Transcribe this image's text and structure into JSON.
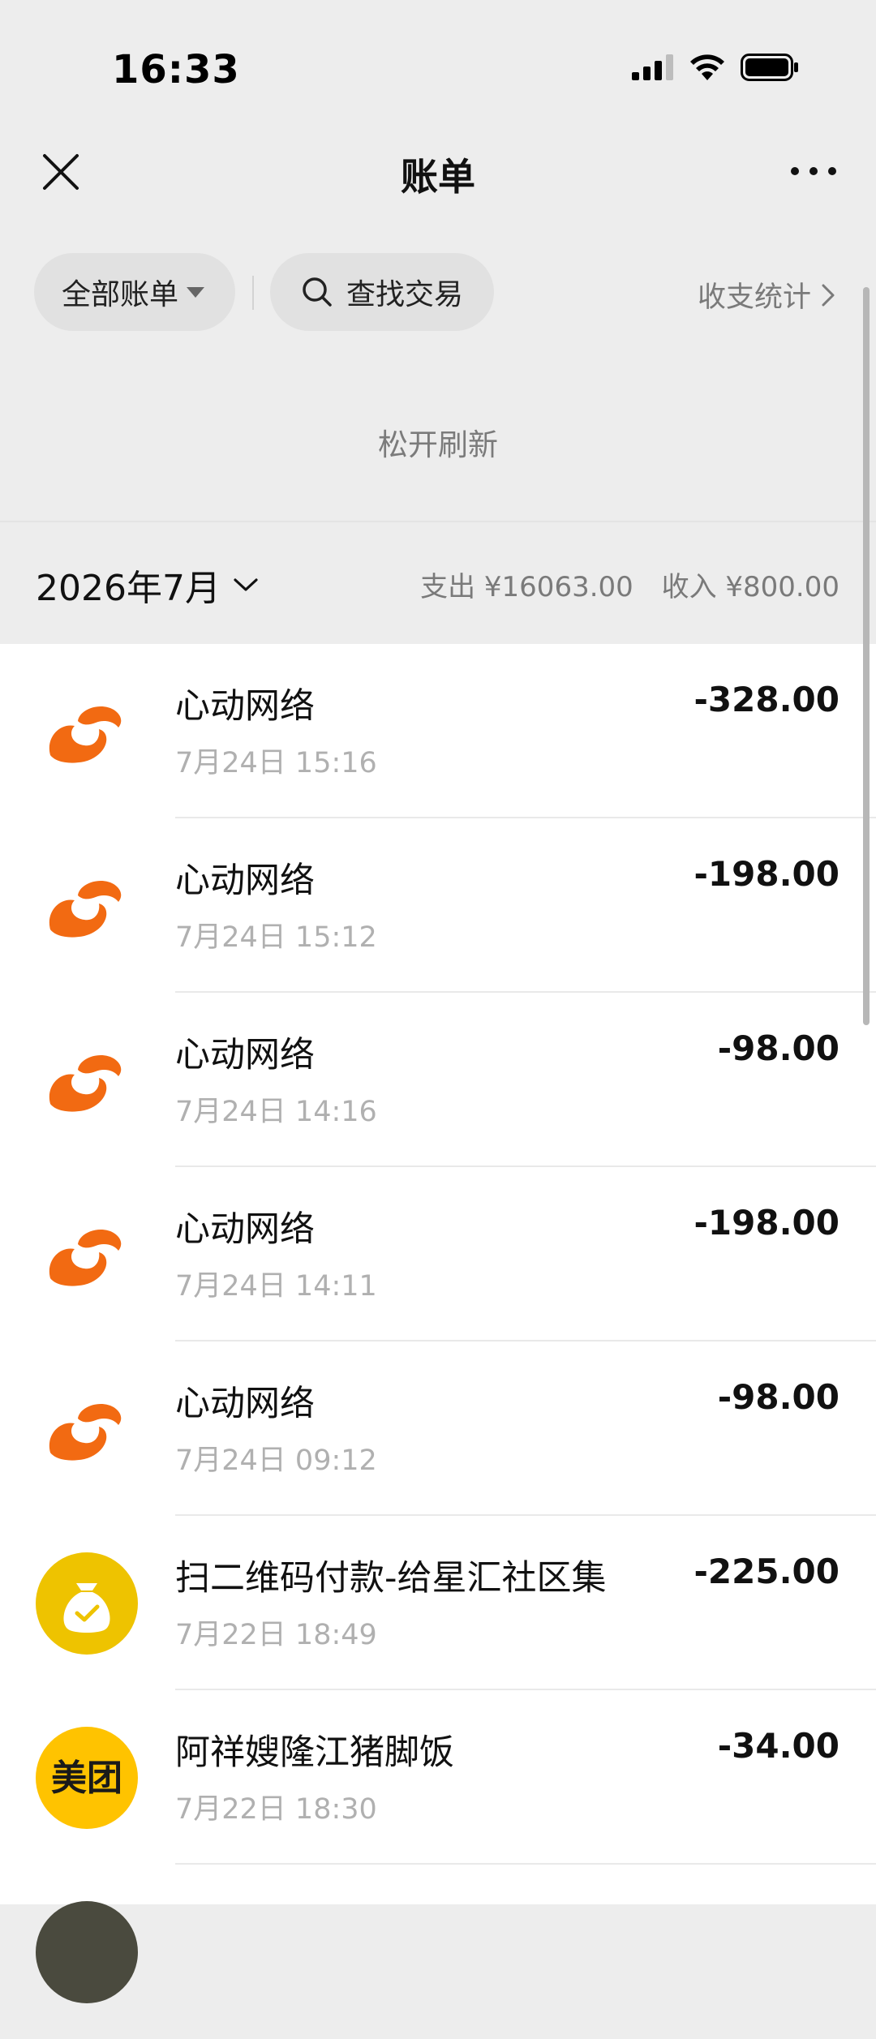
{
  "status_bar": {
    "time": "16:33"
  },
  "nav": {
    "title": "账单"
  },
  "filters": {
    "all_bills": "全部账单",
    "search": "查找交易",
    "stats": "收支统计"
  },
  "refresh_hint": "松开刷新",
  "month": {
    "label": "2026年7月",
    "expense": "支出 ¥16063.00",
    "income": "收入 ¥800.00"
  },
  "transactions": [
    {
      "name": "心动网络",
      "time": "7月24日 15:16",
      "amount": "-328.00",
      "icon": "xd-logo-icon"
    },
    {
      "name": "心动网络",
      "time": "7月24日 15:12",
      "amount": "-198.00",
      "icon": "xd-logo-icon"
    },
    {
      "name": "心动网络",
      "time": "7月24日 14:16",
      "amount": "-98.00",
      "icon": "xd-logo-icon"
    },
    {
      "name": "心动网络",
      "time": "7月24日 14:11",
      "amount": "-198.00",
      "icon": "xd-logo-icon"
    },
    {
      "name": "心动网络",
      "time": "7月24日 09:12",
      "amount": "-98.00",
      "icon": "xd-logo-icon"
    },
    {
      "name": "扫二维码付款-给星汇社区集",
      "time": "7月22日 18:49",
      "amount": "-225.00",
      "icon": "money-bag-icon"
    },
    {
      "name": "阿祥嫂隆江猪脚饭",
      "time": "7月22日 18:30",
      "amount": "-34.00",
      "icon": "meituan-logo-icon",
      "icon_text": "美团"
    }
  ],
  "colors": {
    "page_bg": "#ededed",
    "list_bg": "#ffffff",
    "xd_orange": "#f26a12",
    "money_bag_yellow": "#eec300",
    "meituan_yellow": "#ffc300"
  }
}
